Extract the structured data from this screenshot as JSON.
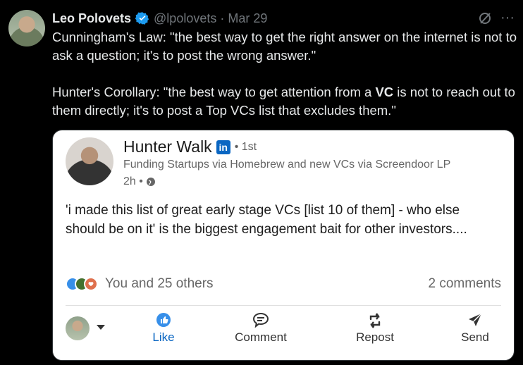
{
  "tweet": {
    "author_name": "Leo Polovets",
    "handle_date": "@lpolovets · Mar 29",
    "paragraph1": "Cunningham's Law: \"the best way to get the right answer on the internet is not to ask a question; it's to post the wrong answer.\"",
    "paragraph2_pre": "Hunter's Corollary: \"the best way to get attention from a ",
    "paragraph2_bold": "VC",
    "paragraph2_post": " is not to reach out to them directly; it's to post a Top VCs list that excludes them.\"",
    "more_label": "···"
  },
  "card": {
    "author_name": "Hunter Walk",
    "badge": "in",
    "degree": "• 1st",
    "headline": "Funding Startups via Homebrew and new VCs via Screendoor LP",
    "time": "2h •",
    "body": "'i made this list of great early stage VCs [list 10 of them] - who else should be on it' is the biggest engagement bait for other investors....",
    "reactions_text": "You and 25 others",
    "comments_text": "2 comments",
    "actions": {
      "like": "Like",
      "comment": "Comment",
      "repost": "Repost",
      "send": "Send"
    }
  },
  "colors": {
    "background": "#000000",
    "verified": "#1d9bf0",
    "linkedin_blue": "#0a66c2"
  }
}
